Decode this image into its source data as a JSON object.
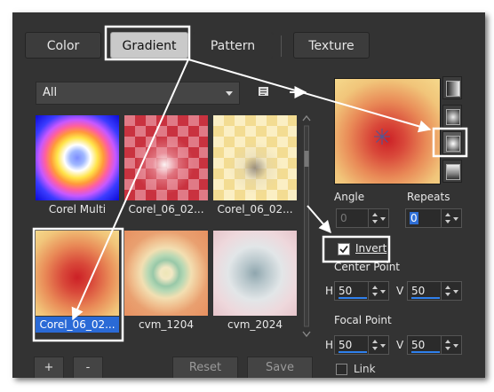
{
  "tabs": [
    {
      "label": "Color"
    },
    {
      "label": "Gradient"
    },
    {
      "label": "Pattern"
    },
    {
      "label": "Texture"
    }
  ],
  "filter": {
    "selected": "All"
  },
  "gradients": [
    {
      "label": "Corel Multi"
    },
    {
      "label": "Corel_06_02..."
    },
    {
      "label": "Corel_06_02..."
    },
    {
      "label": "Corel_06_02..."
    },
    {
      "label": "cvm_1204"
    },
    {
      "label": "cvm_2024"
    }
  ],
  "controls": {
    "angle_label": "Angle",
    "angle_value": "0",
    "repeats_label": "Repeats",
    "repeats_value": "0",
    "invert_label": "Invert",
    "invert_checked": true,
    "center_point_label": "Center Point",
    "center_h_label": "H",
    "center_h_value": "50",
    "center_v_label": "V",
    "center_v_value": "50",
    "focal_point_label": "Focal Point",
    "focal_h_label": "H",
    "focal_h_value": "50",
    "focal_v_label": "V",
    "focal_v_value": "50",
    "link_label": "Link"
  },
  "bottom": {
    "add_label": "+",
    "remove_label": "-",
    "reset_label": "Reset",
    "save_label": "Save"
  },
  "icons": {
    "dropdown": "chevron-down-icon",
    "library": "library-icon",
    "crosshair": "crosshair-icon"
  },
  "colors": {
    "panel_bg": "#333333",
    "highlight": "#ffffff",
    "selection": "#2a6ad6"
  }
}
